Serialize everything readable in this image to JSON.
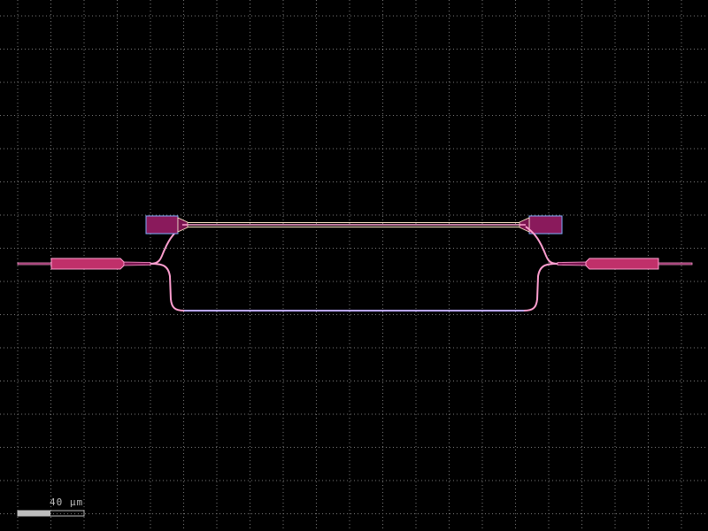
{
  "canvas": {
    "background": "#000000"
  },
  "grid": {
    "visible": true,
    "color": "#7a7a7a",
    "dot_style": "dotted"
  },
  "colors": {
    "waveguide_outline": "#ff9fd0",
    "waveguide_fill": "#c0306a",
    "waveguide_fill_dark": "#7a1550",
    "pad_fill": "#8a1a5c",
    "pad_outline": "#7fb0ff",
    "heater_line": "#ffe9c8",
    "lower_arm_glow": "#b9a6ff",
    "scale_bar": "#bdbdbd"
  },
  "components": [
    {
      "name": "input-grating-coupler",
      "kind": "taper"
    },
    {
      "name": "splitter-y-branch",
      "kind": "mmi"
    },
    {
      "name": "upper-arm-heater",
      "kind": "heater"
    },
    {
      "name": "lower-arm",
      "kind": "waveguide"
    },
    {
      "name": "combiner-y-branch",
      "kind": "mmi"
    },
    {
      "name": "output-grating-coupler",
      "kind": "taper"
    }
  ],
  "scale_bar": {
    "label": "40 µm"
  }
}
